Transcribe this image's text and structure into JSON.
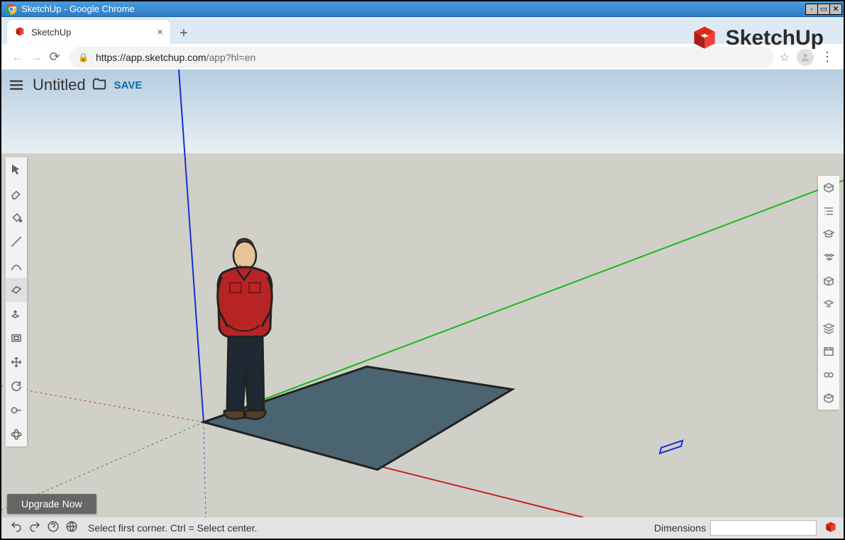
{
  "window_title": "SketchUp - Google Chrome",
  "tab": {
    "title": "SketchUp"
  },
  "url": {
    "host": "https://app.sketchup.com",
    "path": "/app?hl=en"
  },
  "appbar": {
    "doc_title": "Untitled",
    "save": "SAVE"
  },
  "brand": "SketchUp",
  "upgrade_button": "Upgrade Now",
  "status": {
    "hint": "Select first corner. Ctrl = Select center.",
    "dimensions_label": "Dimensions",
    "dimensions_value": ""
  },
  "left_tools": [
    "select",
    "eraser",
    "paint-bucket",
    "pencil",
    "arc",
    "rectangle",
    "push-pull",
    "offset",
    "move",
    "rotate",
    "tape-measure",
    "orbit"
  ],
  "right_panels": [
    "entity-info",
    "outliner",
    "instructor",
    "components",
    "materials",
    "styles",
    "layers",
    "scenes",
    "display",
    "3d-warehouse"
  ]
}
